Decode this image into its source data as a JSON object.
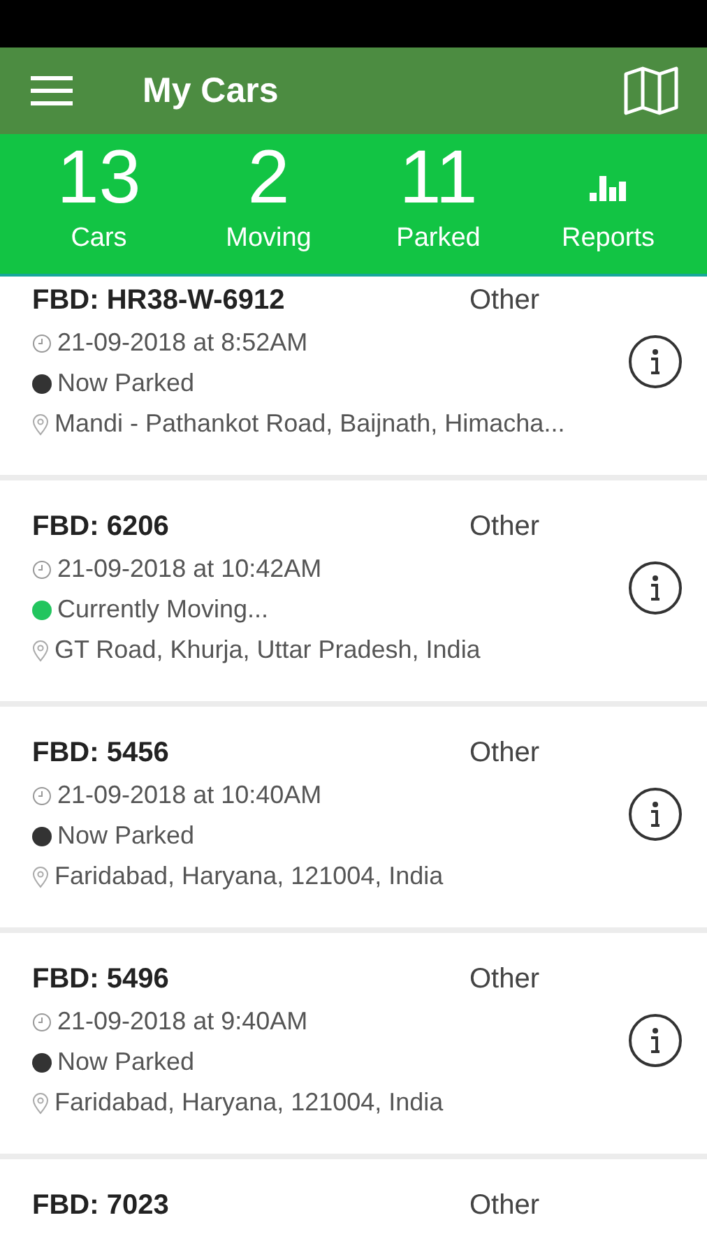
{
  "app_bar": {
    "title": "My Cars"
  },
  "stats": [
    {
      "kind": "count",
      "value": "13",
      "label": "Cars"
    },
    {
      "kind": "count",
      "value": "2",
      "label": "Moving"
    },
    {
      "kind": "count",
      "value": "11",
      "label": "Parked"
    },
    {
      "kind": "reports",
      "label": "Reports"
    }
  ],
  "cars": [
    {
      "name": "FBD: HR38-W-6912",
      "type": "Other",
      "time": "21-09-2018 at 8:52AM",
      "status": "Now Parked",
      "color": "#333333",
      "address": "Mandi - Pathankot Road, Baijnath, Himacha..."
    },
    {
      "name": "FBD: 6206",
      "type": "Other",
      "time": "21-09-2018 at 10:42AM",
      "status": "Currently Moving...",
      "color": "#22c55e",
      "address": "GT Road, Khurja, Uttar Pradesh, India"
    },
    {
      "name": "FBD: 5456",
      "type": "Other",
      "time": "21-09-2018 at 10:40AM",
      "status": "Now Parked",
      "color": "#333333",
      "address": "Faridabad, Haryana, 121004, India"
    },
    {
      "name": "FBD: 5496",
      "type": "Other",
      "time": "21-09-2018 at 9:40AM",
      "status": "Now Parked",
      "color": "#333333",
      "address": "Faridabad, Haryana, 121004, India"
    },
    {
      "name": "FBD: 7023",
      "type": "Other"
    }
  ]
}
